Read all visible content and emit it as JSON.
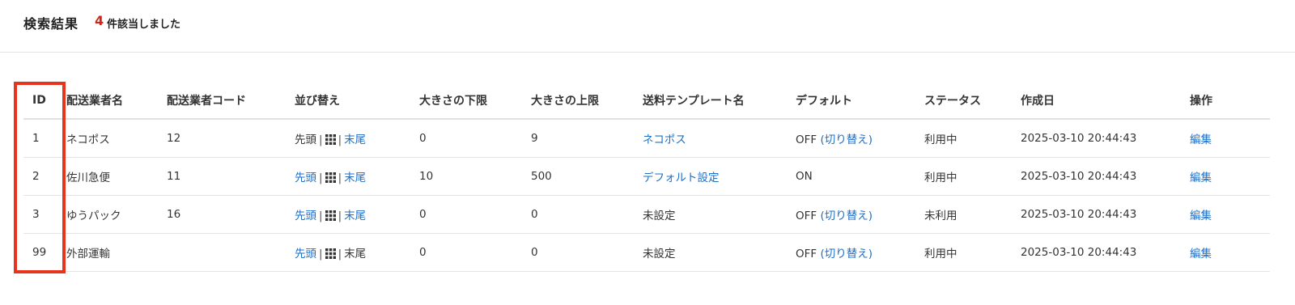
{
  "header": {
    "title": "検索結果",
    "count": "4",
    "count_suffix": "件該当しました"
  },
  "table": {
    "columns": [
      "ID",
      "配送業者名",
      "配送業者コード",
      "並び替え",
      "大きさの下限",
      "大きさの上限",
      "送料テンプレート名",
      "デフォルト",
      "ステータス",
      "作成日",
      "操作"
    ],
    "rows": [
      {
        "id": "1",
        "name": "ネコポス",
        "code": "12",
        "sort_first": "先頭",
        "sort_last": "末尾",
        "lower": "0",
        "upper": "9",
        "template": "ネコポス",
        "default_state": "OFF",
        "default_toggle": "(切り替え)",
        "status": "利用中",
        "created": "2025-03-10 20:44:43",
        "action": "編集"
      },
      {
        "id": "2",
        "name": "佐川急便",
        "code": "11",
        "sort_first": "先頭",
        "sort_last": "末尾",
        "lower": "10",
        "upper": "500",
        "template": "デフォルト設定",
        "default_state": "ON",
        "default_toggle": "",
        "status": "利用中",
        "created": "2025-03-10 20:44:43",
        "action": "編集"
      },
      {
        "id": "3",
        "name": "ゆうパック",
        "code": "16",
        "sort_first": "先頭",
        "sort_last": "末尾",
        "lower": "0",
        "upper": "0",
        "template": "未設定",
        "default_state": "OFF",
        "default_toggle": "(切り替え)",
        "status": "未利用",
        "created": "2025-03-10 20:44:43",
        "action": "編集"
      },
      {
        "id": "99",
        "name": "外部運輸",
        "code": "",
        "sort_first": "先頭",
        "sort_last": "末尾",
        "lower": "0",
        "upper": "0",
        "template": "未設定",
        "default_state": "OFF",
        "default_toggle": "(切り替え)",
        "status": "利用中",
        "created": "2025-03-10 20:44:43",
        "action": "編集"
      }
    ]
  },
  "sort_separator": "|",
  "icons": {
    "reorder": "grid-drag-icon"
  },
  "colors": {
    "link": "#1f6fc5",
    "count": "#d0261a",
    "highlight": "#e8341c"
  }
}
